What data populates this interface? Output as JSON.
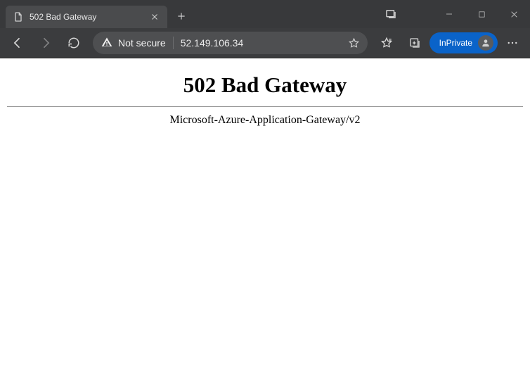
{
  "tab": {
    "title": "502 Bad Gateway"
  },
  "address_bar": {
    "security_label": "Not secure",
    "url": "52.149.106.34"
  },
  "profile": {
    "inprivate_label": "InPrivate"
  },
  "page": {
    "heading": "502 Bad Gateway",
    "server": "Microsoft-Azure-Application-Gateway/v2"
  }
}
